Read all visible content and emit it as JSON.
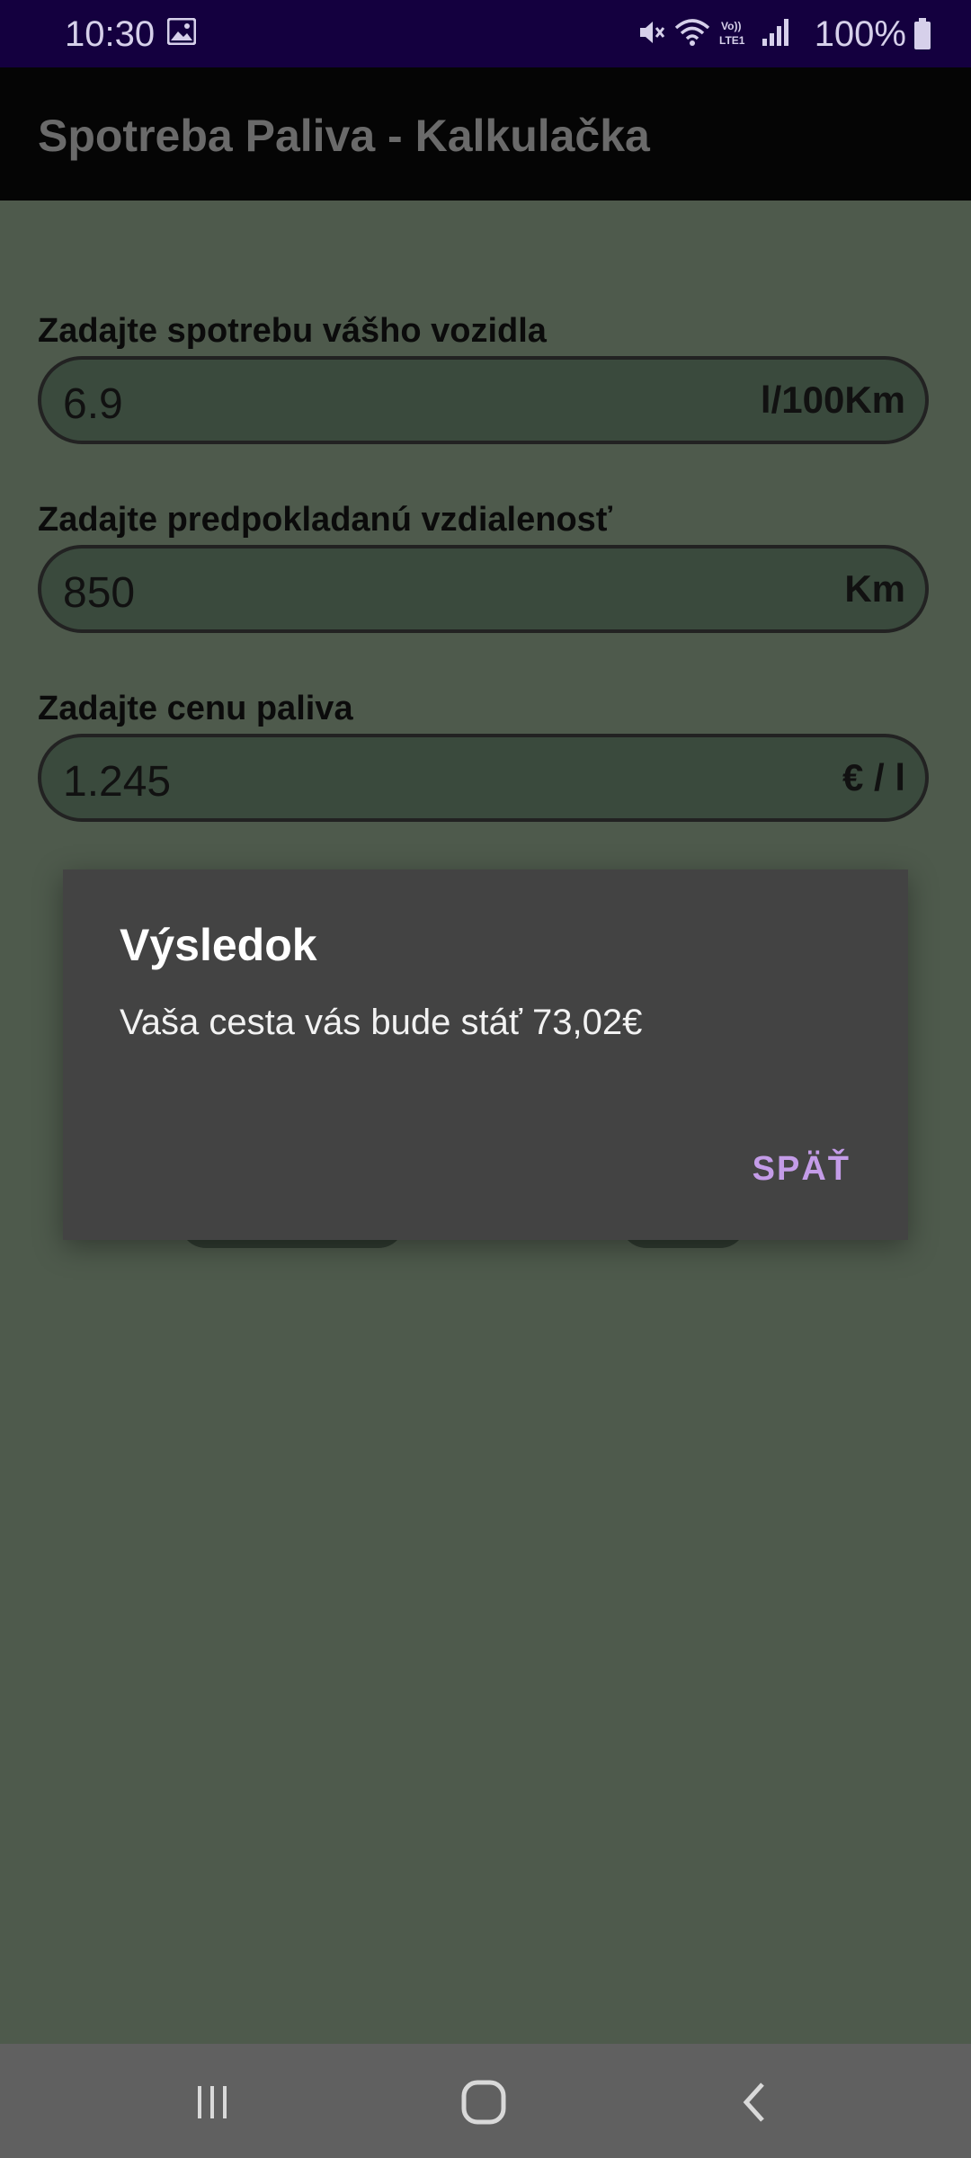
{
  "status_bar": {
    "time": "10:30",
    "battery": "100%",
    "icons": [
      "gallery-icon",
      "mute-icon",
      "wifi-icon",
      "volte-icon",
      "signal-icon",
      "battery-icon"
    ],
    "background": "#14003f"
  },
  "app_bar": {
    "title": "Spotreba Paliva - Kalkulačka"
  },
  "form": {
    "consumption": {
      "label": "Zadajte spotrebu vášho vozidla",
      "value": "6.9",
      "unit": "l/100Km"
    },
    "distance": {
      "label": "Zadajte predpokladanú vzdialenosť",
      "value": "850",
      "unit": "Km"
    },
    "price": {
      "label": "Zadajte cenu paliva",
      "value": "1.245",
      "unit": "€ / l"
    }
  },
  "dialog": {
    "title": "Výsledok",
    "message": "Vaša cesta vás bude stáť 73,02€",
    "button_label": "SPÄŤ",
    "accent_color": "#c49ce8"
  },
  "nav_bar": {
    "icons": [
      "recent-apps-icon",
      "home-icon",
      "back-icon"
    ]
  }
}
